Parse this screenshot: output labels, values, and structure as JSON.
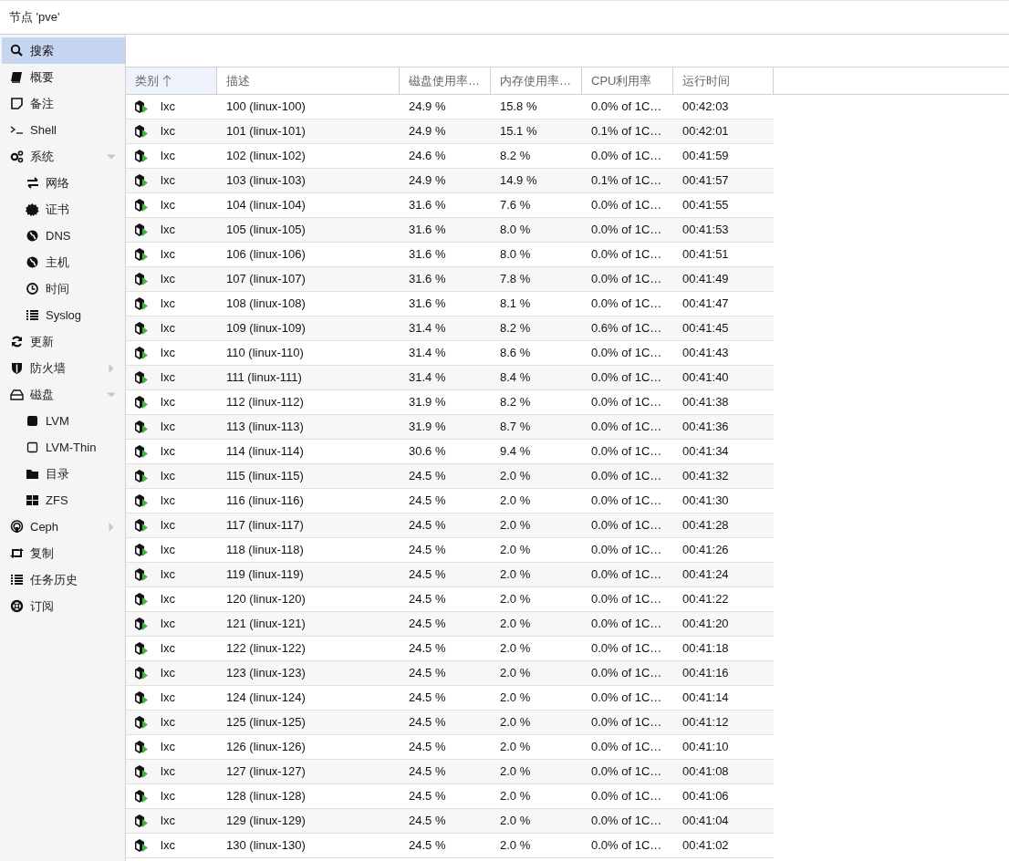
{
  "window": {
    "title": "节点 'pve'"
  },
  "sidebar": {
    "items": [
      {
        "label": "搜索",
        "selected": true
      },
      {
        "label": "概要",
        "selected": false
      },
      {
        "label": "备注",
        "selected": false
      },
      {
        "label": "Shell",
        "selected": false
      },
      {
        "label": "系统",
        "selected": false,
        "expanded": true,
        "children": [
          {
            "label": "网络",
            "selected": false
          },
          {
            "label": "证书",
            "selected": false
          },
          {
            "label": "DNS",
            "selected": false
          },
          {
            "label": "主机",
            "selected": false
          },
          {
            "label": "时间",
            "selected": false
          },
          {
            "label": "Syslog",
            "selected": false
          }
        ]
      },
      {
        "label": "更新",
        "selected": false
      },
      {
        "label": "防火墙",
        "selected": false,
        "expanded": false
      },
      {
        "label": "磁盘",
        "selected": false,
        "expanded": true,
        "children": [
          {
            "label": "LVM",
            "selected": false
          },
          {
            "label": "LVM-Thin",
            "selected": false
          },
          {
            "label": "目录",
            "selected": false
          },
          {
            "label": "ZFS",
            "selected": false
          }
        ]
      },
      {
        "label": "Ceph",
        "selected": false,
        "expanded": false
      },
      {
        "label": "复制",
        "selected": false
      },
      {
        "label": "任务历史",
        "selected": false
      },
      {
        "label": "订阅",
        "selected": false
      }
    ]
  },
  "table": {
    "columns": [
      {
        "label": "类别",
        "sorted": true
      },
      {
        "label": "描述",
        "sorted": false
      },
      {
        "label": "磁盘使用率…",
        "sorted": false
      },
      {
        "label": "内存使用率…",
        "sorted": false
      },
      {
        "label": "CPU利用率",
        "sorted": false
      },
      {
        "label": "运行时间",
        "sorted": false
      }
    ],
    "rows": [
      [
        "lxc",
        "100 (linux-100)",
        "24.9 %",
        "15.8 %",
        "0.0% of 1C…",
        "00:42:03"
      ],
      [
        "lxc",
        "101 (linux-101)",
        "24.9 %",
        "15.1 %",
        "0.1% of 1C…",
        "00:42:01"
      ],
      [
        "lxc",
        "102 (linux-102)",
        "24.6 %",
        "8.2 %",
        "0.0% of 1C…",
        "00:41:59"
      ],
      [
        "lxc",
        "103 (linux-103)",
        "24.9 %",
        "14.9 %",
        "0.1% of 1C…",
        "00:41:57"
      ],
      [
        "lxc",
        "104 (linux-104)",
        "31.6 %",
        "7.6 %",
        "0.0% of 1C…",
        "00:41:55"
      ],
      [
        "lxc",
        "105 (linux-105)",
        "31.6 %",
        "8.0 %",
        "0.0% of 1C…",
        "00:41:53"
      ],
      [
        "lxc",
        "106 (linux-106)",
        "31.6 %",
        "8.0 %",
        "0.0% of 1C…",
        "00:41:51"
      ],
      [
        "lxc",
        "107 (linux-107)",
        "31.6 %",
        "7.8 %",
        "0.0% of 1C…",
        "00:41:49"
      ],
      [
        "lxc",
        "108 (linux-108)",
        "31.6 %",
        "8.1 %",
        "0.0% of 1C…",
        "00:41:47"
      ],
      [
        "lxc",
        "109 (linux-109)",
        "31.4 %",
        "8.2 %",
        "0.6% of 1C…",
        "00:41:45"
      ],
      [
        "lxc",
        "110 (linux-110)",
        "31.4 %",
        "8.6 %",
        "0.0% of 1C…",
        "00:41:43"
      ],
      [
        "lxc",
        "111 (linux-111)",
        "31.4 %",
        "8.4 %",
        "0.0% of 1C…",
        "00:41:40"
      ],
      [
        "lxc",
        "112 (linux-112)",
        "31.9 %",
        "8.2 %",
        "0.0% of 1C…",
        "00:41:38"
      ],
      [
        "lxc",
        "113 (linux-113)",
        "31.9 %",
        "8.7 %",
        "0.0% of 1C…",
        "00:41:36"
      ],
      [
        "lxc",
        "114 (linux-114)",
        "30.6 %",
        "9.4 %",
        "0.0% of 1C…",
        "00:41:34"
      ],
      [
        "lxc",
        "115 (linux-115)",
        "24.5 %",
        "2.0 %",
        "0.0% of 1C…",
        "00:41:32"
      ],
      [
        "lxc",
        "116 (linux-116)",
        "24.5 %",
        "2.0 %",
        "0.0% of 1C…",
        "00:41:30"
      ],
      [
        "lxc",
        "117 (linux-117)",
        "24.5 %",
        "2.0 %",
        "0.0% of 1C…",
        "00:41:28"
      ],
      [
        "lxc",
        "118 (linux-118)",
        "24.5 %",
        "2.0 %",
        "0.0% of 1C…",
        "00:41:26"
      ],
      [
        "lxc",
        "119 (linux-119)",
        "24.5 %",
        "2.0 %",
        "0.0% of 1C…",
        "00:41:24"
      ],
      [
        "lxc",
        "120 (linux-120)",
        "24.5 %",
        "2.0 %",
        "0.0% of 1C…",
        "00:41:22"
      ],
      [
        "lxc",
        "121 (linux-121)",
        "24.5 %",
        "2.0 %",
        "0.0% of 1C…",
        "00:41:20"
      ],
      [
        "lxc",
        "122 (linux-122)",
        "24.5 %",
        "2.0 %",
        "0.0% of 1C…",
        "00:41:18"
      ],
      [
        "lxc",
        "123 (linux-123)",
        "24.5 %",
        "2.0 %",
        "0.0% of 1C…",
        "00:41:16"
      ],
      [
        "lxc",
        "124 (linux-124)",
        "24.5 %",
        "2.0 %",
        "0.0% of 1C…",
        "00:41:14"
      ],
      [
        "lxc",
        "125 (linux-125)",
        "24.5 %",
        "2.0 %",
        "0.0% of 1C…",
        "00:41:12"
      ],
      [
        "lxc",
        "126 (linux-126)",
        "24.5 %",
        "2.0 %",
        "0.0% of 1C…",
        "00:41:10"
      ],
      [
        "lxc",
        "127 (linux-127)",
        "24.5 %",
        "2.0 %",
        "0.0% of 1C…",
        "00:41:08"
      ],
      [
        "lxc",
        "128 (linux-128)",
        "24.5 %",
        "2.0 %",
        "0.0% of 1C…",
        "00:41:06"
      ],
      [
        "lxc",
        "129 (linux-129)",
        "24.5 %",
        "2.0 %",
        "0.0% of 1C…",
        "00:41:04"
      ],
      [
        "lxc",
        "130 (linux-130)",
        "24.5 %",
        "2.0 %",
        "0.0% of 1C…",
        "00:41:02"
      ]
    ]
  }
}
